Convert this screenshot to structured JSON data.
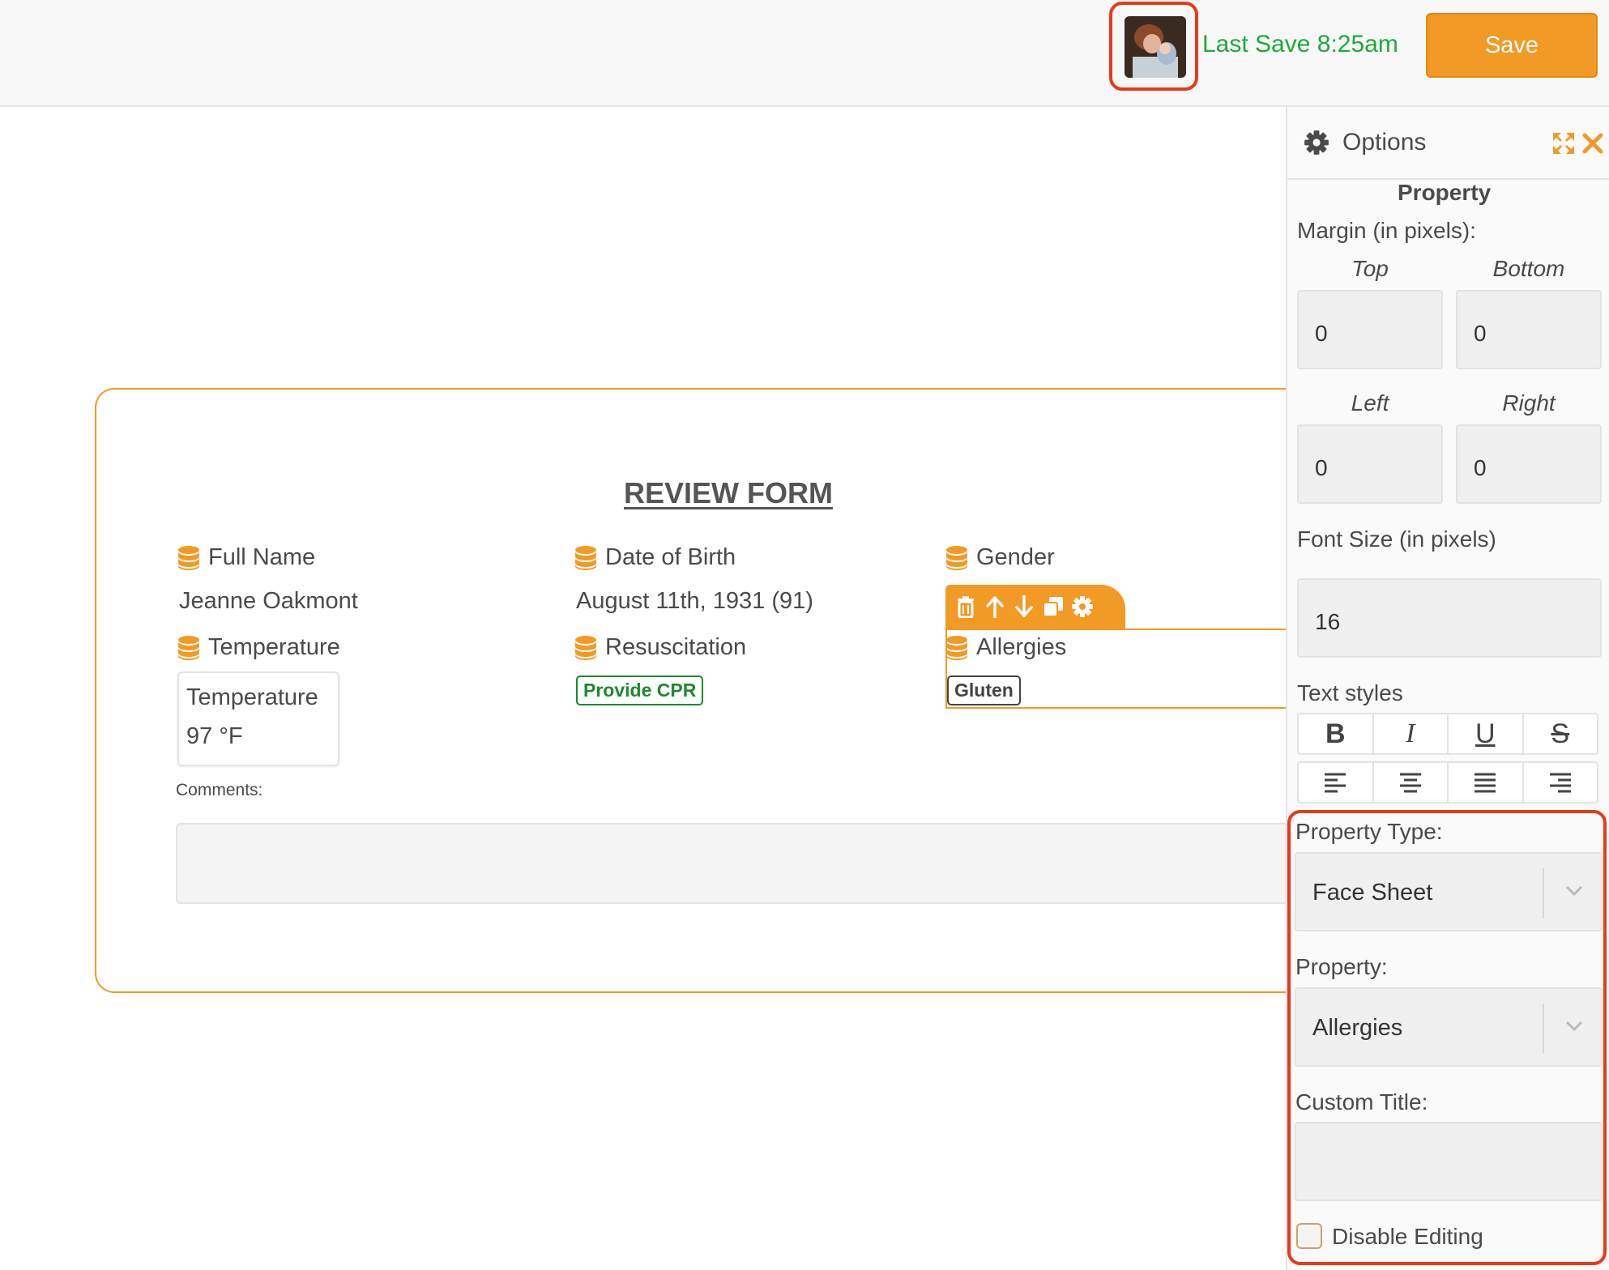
{
  "header": {
    "last_save": "Last Save 8:25am",
    "save_label": "Save"
  },
  "form": {
    "title": "REVIEW FORM",
    "fields": {
      "full_name": {
        "label": "Full Name",
        "value": "Jeanne Oakmont"
      },
      "dob": {
        "label": "Date of Birth",
        "value": "August 11th, 1931 (91)"
      },
      "gender": {
        "label": "Gender"
      },
      "temperature": {
        "label": "Temperature",
        "box_title": "Temperature",
        "box_value": "97 °F"
      },
      "resuscitation": {
        "label": "Resuscitation",
        "badge": "Provide CPR"
      },
      "allergies": {
        "label": "Allergies",
        "badge": "Gluten"
      }
    },
    "comments_label": "Comments:"
  },
  "options": {
    "title": "Options",
    "section": "Property",
    "margin_label": "Margin (in pixels):",
    "top_label": "Top",
    "bottom_label": "Bottom",
    "left_label": "Left",
    "right_label": "Right",
    "top_value": "0",
    "bottom_value": "0",
    "left_value": "0",
    "right_value": "0",
    "font_size_label": "Font Size (in pixels)",
    "font_size_value": "16",
    "text_styles_label": "Text styles",
    "property_type_label": "Property Type:",
    "property_type_value": "Face Sheet",
    "property_label": "Property:",
    "property_value": "Allergies",
    "custom_title_label": "Custom Title:",
    "custom_title_value": "",
    "disable_editing_label": "Disable Editing"
  },
  "colors": {
    "accent": "#f29a26",
    "highlight": "#e8391a",
    "save_text": "#1faa3a",
    "badge_green": "#1d8a2e"
  },
  "icons": [
    "gear-icon",
    "expand-icon",
    "close-icon",
    "database-icon",
    "trash-icon",
    "arrow-up-icon",
    "arrow-down-icon",
    "copy-icon",
    "chevron-down-icon"
  ]
}
